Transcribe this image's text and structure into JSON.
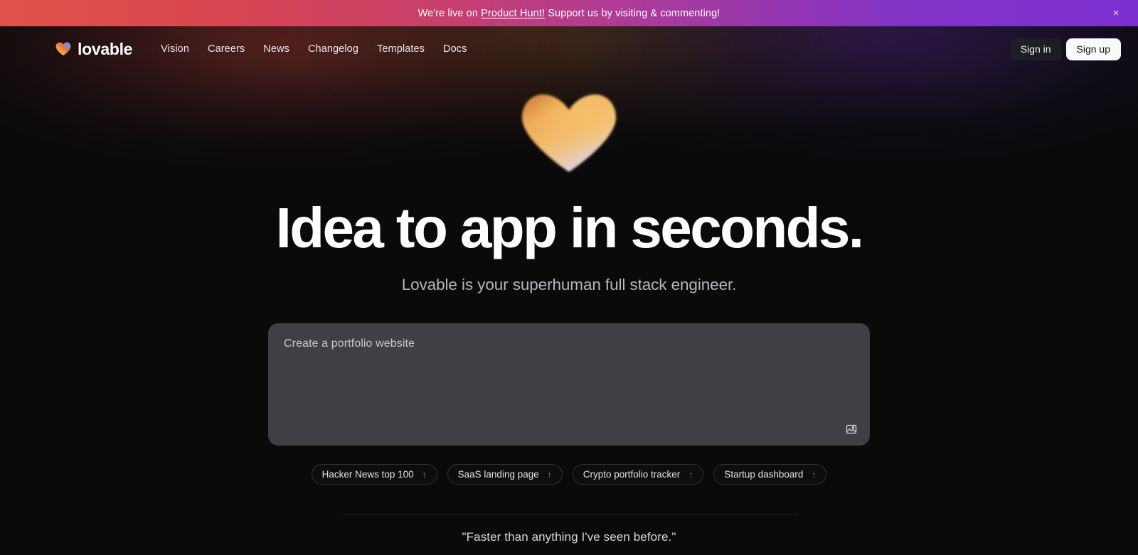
{
  "banner": {
    "prefix": "We're live on ",
    "link": "Product Hunt!",
    "suffix": " Support us by visiting & commenting!",
    "close_icon": "close-icon",
    "close_glyph": "×",
    "gradient_from": "#e0524a",
    "gradient_to": "#7b2fd1"
  },
  "nav": {
    "brand": "lovable",
    "brand_icon": "heart-logo-icon",
    "links": [
      {
        "label": "Vision"
      },
      {
        "label": "Careers"
      },
      {
        "label": "News"
      },
      {
        "label": "Changelog"
      },
      {
        "label": "Templates"
      },
      {
        "label": "Docs"
      }
    ],
    "sign_in": "Sign in",
    "sign_up": "Sign up"
  },
  "hero": {
    "heart_icon": "heart-gradient-icon",
    "headline": "Idea to app in seconds.",
    "subhead": "Lovable is your superhuman full stack engineer."
  },
  "prompt": {
    "placeholder": "Create a portfolio website",
    "value": "",
    "attach_icon": "image-attach-icon",
    "background": "#3f3f46"
  },
  "chips": [
    {
      "label": "Hacker News top 100",
      "arrow": "↑",
      "icon": "arrow-up-icon"
    },
    {
      "label": "SaaS landing page",
      "arrow": "↑",
      "icon": "arrow-up-icon"
    },
    {
      "label": "Crypto portfolio tracker",
      "arrow": "↑",
      "icon": "arrow-up-icon"
    },
    {
      "label": "Startup dashboard",
      "arrow": "↑",
      "icon": "arrow-up-icon"
    }
  ],
  "testimonial": {
    "quote": "\"Faster than anything I've seen before.\""
  }
}
